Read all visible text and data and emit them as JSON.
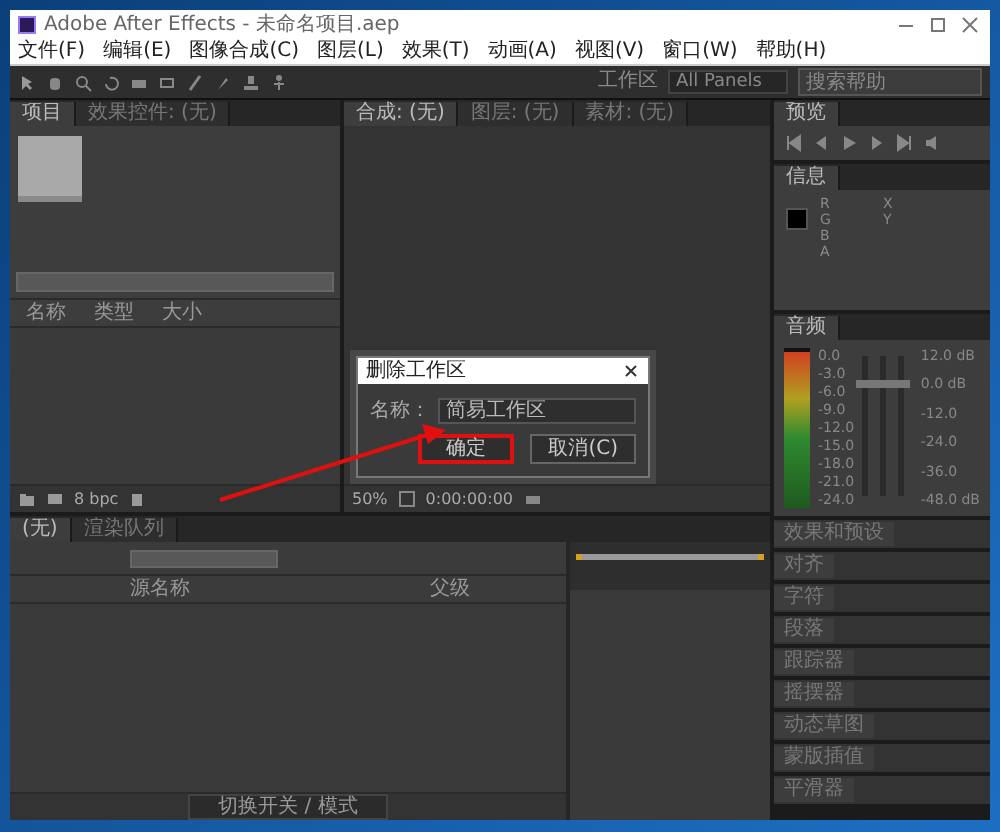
{
  "window": {
    "title": "Adobe After Effects - 未命名项目.aep"
  },
  "menu": [
    "文件(F)",
    "编辑(E)",
    "图像合成(C)",
    "图层(L)",
    "效果(T)",
    "动画(A)",
    "视图(V)",
    "窗口(W)",
    "帮助(H)"
  ],
  "toolbar": {
    "workspace_label": "工作区",
    "workspace": "All Panels",
    "search": {
      "placeholder": "搜索帮助"
    }
  },
  "project_panel": {
    "tabs": [
      {
        "label": "项目",
        "selected": true
      },
      {
        "label": "效果控件: (无)",
        "selected": false
      }
    ],
    "columns": [
      "名称",
      "类型",
      "大小"
    ],
    "depth": "8 bpc"
  },
  "viewer": {
    "tabs": [
      {
        "label": "合成: (无)",
        "selected": true
      },
      {
        "label": "图层: (无)",
        "selected": false
      },
      {
        "label": "素材: (无)",
        "selected": false
      }
    ],
    "zoom": "50%",
    "timecode": "0:00:00:00"
  },
  "timeline": {
    "tabs": [
      {
        "label": "(无)",
        "selected": true
      },
      {
        "label": "渲染队列",
        "selected": false
      }
    ],
    "columns": [
      "源名称",
      "父级"
    ],
    "toggle_button": "切换开关 / 模式"
  },
  "right_panels": {
    "preview": {
      "title": "预览"
    },
    "info": {
      "title": "信息",
      "channels": [
        "R",
        "G",
        "B",
        "A"
      ],
      "coords": [
        "X",
        "Y"
      ]
    },
    "audio": {
      "title": "音频",
      "scale": [
        "0.0",
        "-3.0",
        "-6.0",
        "-9.0",
        "-12.0",
        "-15.0",
        "-18.0",
        "-21.0",
        "-24.0"
      ],
      "db_scale": [
        "12.0 dB",
        "0.0 dB",
        "-12.0",
        "-24.0",
        "-36.0",
        "-48.0 dB"
      ],
      "sliders": [
        {
          "level": 0.8
        },
        {
          "level": 0.8
        },
        {
          "level": 0.8
        }
      ]
    },
    "collapsed": [
      "效果和预设",
      "对齐",
      "字符",
      "段落",
      "跟踪器",
      "摇摆器",
      "动态草图",
      "蒙版插值",
      "平滑器"
    ]
  },
  "dialog": {
    "title": "删除工作区",
    "name_label": "名称：",
    "name_value": "简易工作区",
    "ok": {
      "label": "确定",
      "highlighted": true
    },
    "cancel": "取消(C)"
  }
}
